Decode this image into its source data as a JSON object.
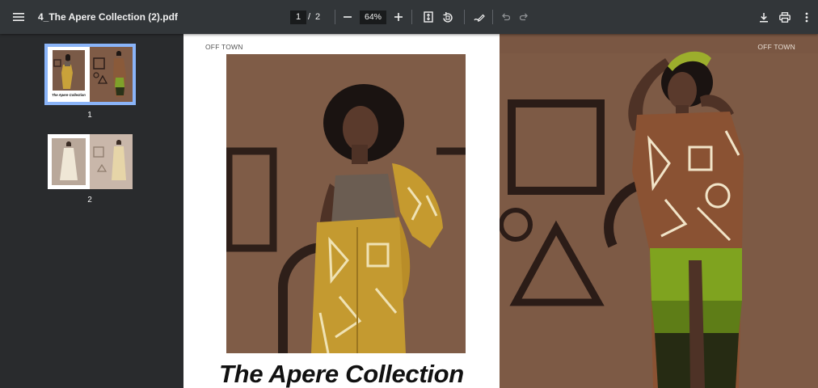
{
  "toolbar": {
    "menu_icon": "hamburger-menu-icon",
    "file_title": "4_The Apere Collection (2).pdf",
    "current_page": "1",
    "page_separator": "/",
    "total_pages": "2",
    "zoom_level": "64%",
    "icons": [
      "zoom-out-icon",
      "zoom-in-icon",
      "fit-to-page-icon",
      "rotate-icon",
      "annotate-icon",
      "undo-icon",
      "redo-icon",
      "download-icon",
      "print-icon",
      "more-options-icon"
    ]
  },
  "sidebar": {
    "thumbnails": [
      {
        "number": "1",
        "selected": true
      },
      {
        "number": "2",
        "selected": false
      }
    ],
    "thumb_caption": "The Apere Collection"
  },
  "document": {
    "brand_left": "OFF TOWN",
    "brand_right": "OFF TOWN",
    "collection_title": "The Apere Collection"
  },
  "colors": {
    "toolbar_bg": "#323639",
    "sidebar_bg": "#292b2d",
    "viewer_bg": "#525659",
    "selection_outline": "#8ab4f8",
    "photo_backdrop": "#7d5a45"
  }
}
